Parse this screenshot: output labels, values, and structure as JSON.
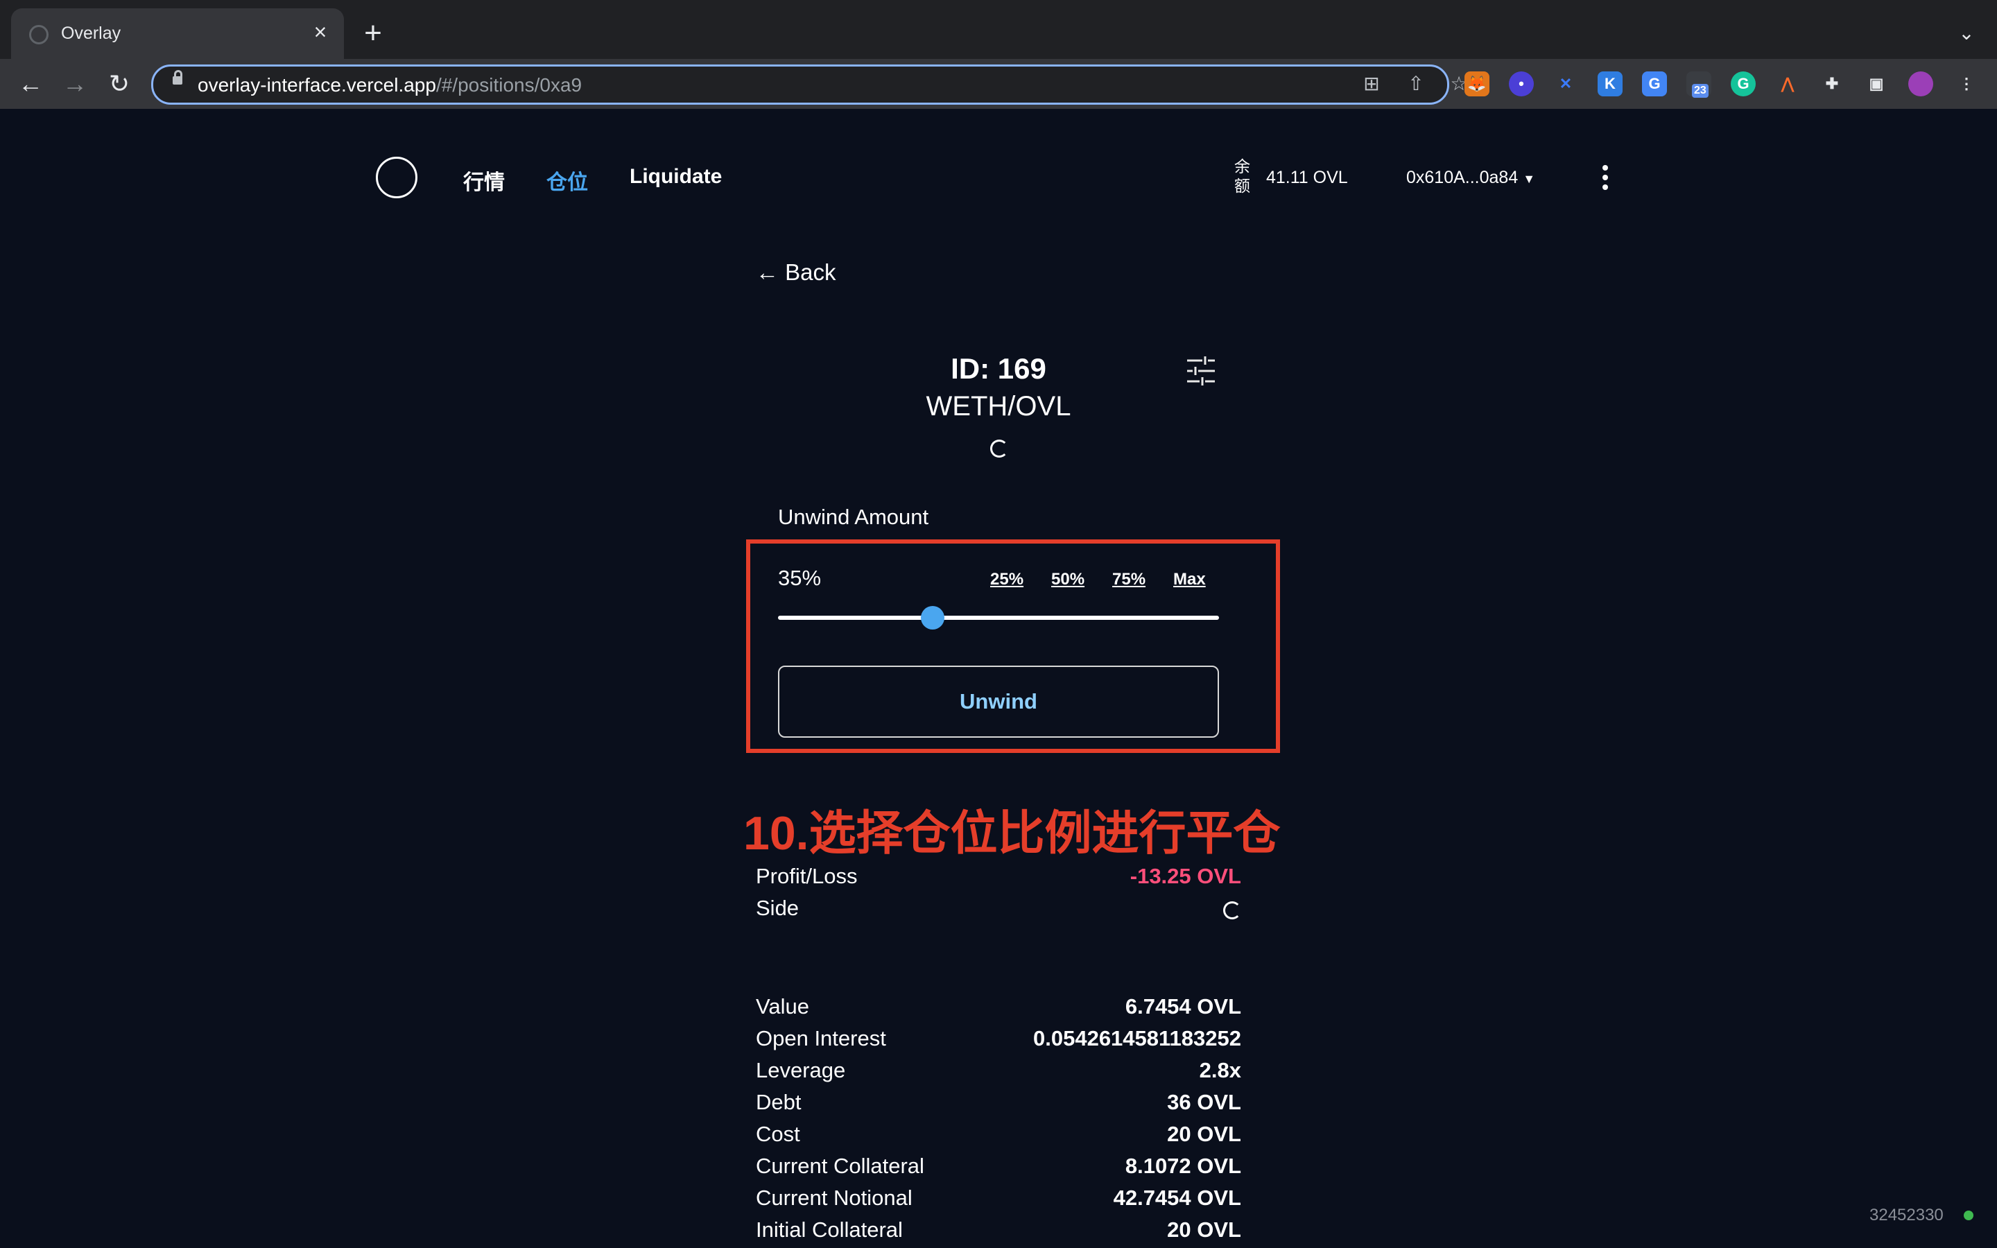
{
  "browser": {
    "tab_title": "Overlay",
    "url_host": "overlay-interface.vercel.app",
    "url_path": "/#/positions/0xa9",
    "extension_badge": "23"
  },
  "header": {
    "nav": [
      "行情",
      "仓位",
      "Liquidate"
    ],
    "active_nav": "仓位",
    "balance_label": "余额",
    "balance_value": "41.11 OVL",
    "wallet": "0x610A...0a84"
  },
  "position": {
    "back_label": "Back",
    "id_text": "ID: 169",
    "market": "WETH/OVL",
    "unwind_label": "Unwind Amount",
    "unwind_percent": 35,
    "unwind_percent_text": "35%",
    "quick_options": [
      "25%",
      "50%",
      "75%",
      "Max"
    ],
    "unwind_button": "Unwind"
  },
  "annotation": "10.选择仓位比例进行平仓",
  "summary": [
    {
      "label": "Profit/Loss",
      "value": "-13.25 OVL",
      "negative": true
    },
    {
      "label": "Side",
      "value": ""
    }
  ],
  "details": [
    {
      "label": "Value",
      "value": "6.7454 OVL"
    },
    {
      "label": "Open Interest",
      "value": "0.0542614581183252"
    },
    {
      "label": "Leverage",
      "value": "2.8x"
    },
    {
      "label": "Debt",
      "value": "36 OVL"
    },
    {
      "label": "Cost",
      "value": "20 OVL"
    },
    {
      "label": "Current Collateral",
      "value": "8.1072 OVL"
    },
    {
      "label": "Current Notional",
      "value": "42.7454 OVL"
    },
    {
      "label": "Initial Collateral",
      "value": "20 OVL"
    }
  ],
  "footer_id": "32452330",
  "colors": {
    "background": "#0a0f1c",
    "accent": "#4aa6ef",
    "annotation": "#e53e2a",
    "negative": "#ff4f7b",
    "status": "#3fb950"
  }
}
